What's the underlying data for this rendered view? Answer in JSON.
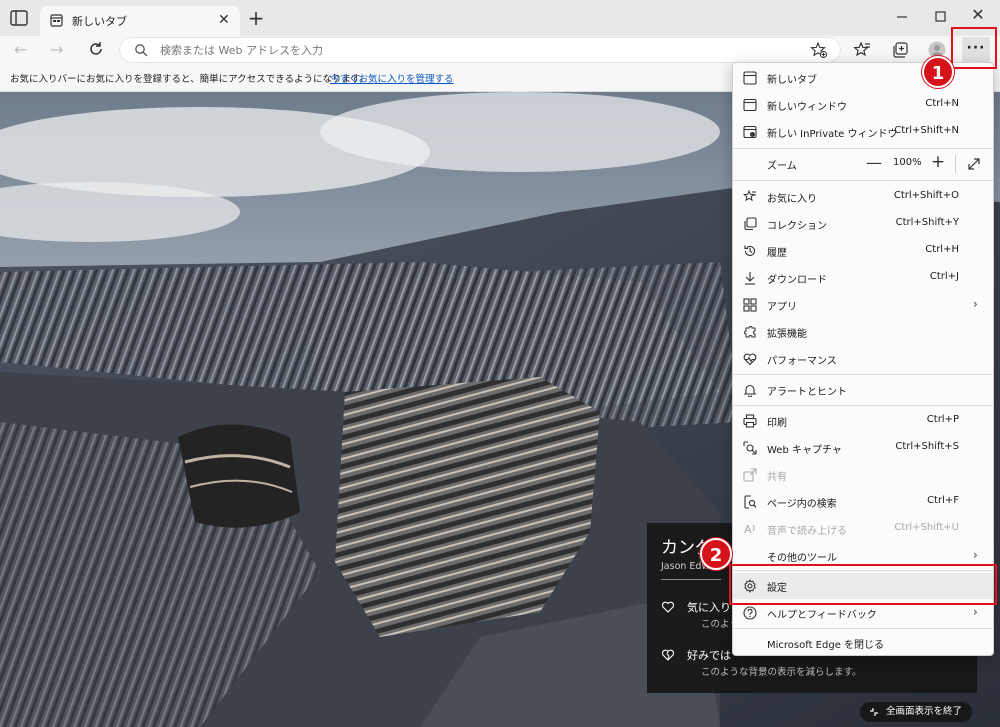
{
  "tab": {
    "title": "新しいタブ"
  },
  "toolbar": {
    "address_placeholder": "検索または Web アドレスを入力"
  },
  "favorites_bar": {
    "text": "お気に入りバーにお気に入りを登録すると、簡単にアクセスできるようになります。",
    "link": "今すぐお気に入りを管理する"
  },
  "info_card": {
    "title": "カング",
    "author": "Jason Edw",
    "row1_title": "気に入り",
    "row1_sub": "このよう",
    "row2_title": "好みでは",
    "row2_sub": "このような背景の表示を減らします。"
  },
  "fullscreen_exit": "全画面表示を終了",
  "menu": {
    "new_tab": {
      "label": "新しいタブ",
      "shortcut": ""
    },
    "new_window": {
      "label": "新しいウィンドウ",
      "shortcut": "Ctrl+N"
    },
    "new_inprivate": {
      "label": "新しい InPrivate ウィンドウ",
      "shortcut": "Ctrl+Shift+N"
    },
    "zoom": {
      "label": "ズーム",
      "value": "100%",
      "minus": "—",
      "plus": "+"
    },
    "favorites": {
      "label": "お気に入り",
      "shortcut": "Ctrl+Shift+O"
    },
    "collections": {
      "label": "コレクション",
      "shortcut": "Ctrl+Shift+Y"
    },
    "history": {
      "label": "履歴",
      "shortcut": "Ctrl+H"
    },
    "downloads": {
      "label": "ダウンロード",
      "shortcut": "Ctrl+J"
    },
    "apps": {
      "label": "アプリ",
      "shortcut": ""
    },
    "extensions": {
      "label": "拡張機能",
      "shortcut": ""
    },
    "performance": {
      "label": "パフォーマンス",
      "shortcut": ""
    },
    "alerts": {
      "label": "アラートとヒント",
      "shortcut": ""
    },
    "print": {
      "label": "印刷",
      "shortcut": "Ctrl+P"
    },
    "web_capture": {
      "label": "Web キャプチャ",
      "shortcut": "Ctrl+Shift+S"
    },
    "share": {
      "label": "共有",
      "shortcut": ""
    },
    "find": {
      "label": "ページ内の検索",
      "shortcut": "Ctrl+F"
    },
    "read_aloud": {
      "label": "音声で読み上げる",
      "shortcut": "Ctrl+Shift+U"
    },
    "more_tools": {
      "label": "その他のツール",
      "shortcut": ""
    },
    "settings": {
      "label": "設定",
      "shortcut": ""
    },
    "help": {
      "label": "ヘルプとフィードバック",
      "shortcut": ""
    },
    "close_edge": {
      "label": "Microsoft Edge を閉じる",
      "shortcut": ""
    }
  },
  "annotations": {
    "badge1": "1",
    "badge2": "2",
    "color": "#e0131d"
  },
  "icons": [
    "tab-actions-icon",
    "newtab-favicon",
    "close-icon",
    "plus-icon",
    "minimize-icon",
    "maximize-icon",
    "back-arrow-icon",
    "forward-arrow-icon",
    "refresh-icon",
    "search-icon",
    "add-favorite-icon",
    "favorites-icon",
    "collections-icon",
    "profile-icon",
    "more-icon"
  ]
}
